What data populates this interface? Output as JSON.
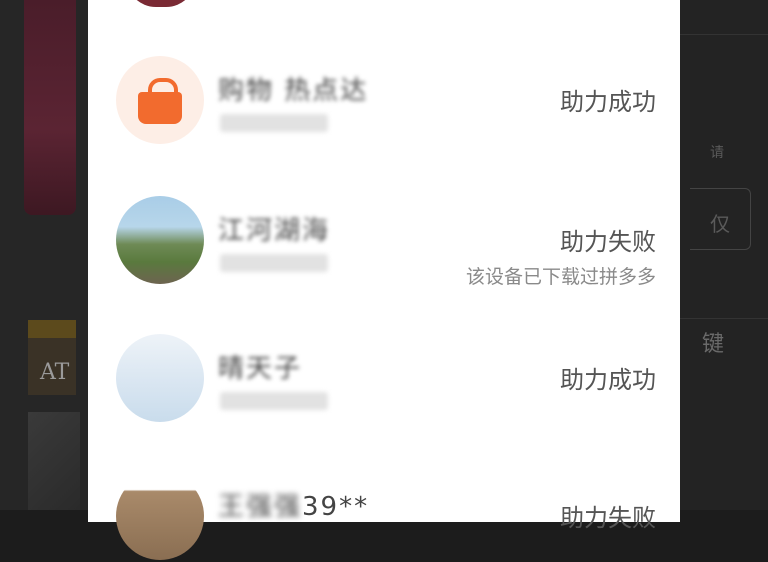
{
  "background": {
    "left_text": "AT",
    "right_texts": [
      "请",
      "仅",
      "键"
    ]
  },
  "modal": {
    "rows": [
      {
        "avatar": "orange-bag-icon",
        "name": "购物 热点达",
        "status": "助力成功",
        "reason": ""
      },
      {
        "avatar": "landscape-photo",
        "name": "江河湖海",
        "status": "助力失败",
        "reason": "该设备已下载过拼多多"
      },
      {
        "avatar": "sky-photo",
        "name": "晴天子",
        "status": "助力成功",
        "reason": ""
      },
      {
        "avatar": "building-photo",
        "name_prefix": "王强强",
        "name_suffix": "39**",
        "status": "助力失败",
        "reason": ""
      }
    ]
  }
}
